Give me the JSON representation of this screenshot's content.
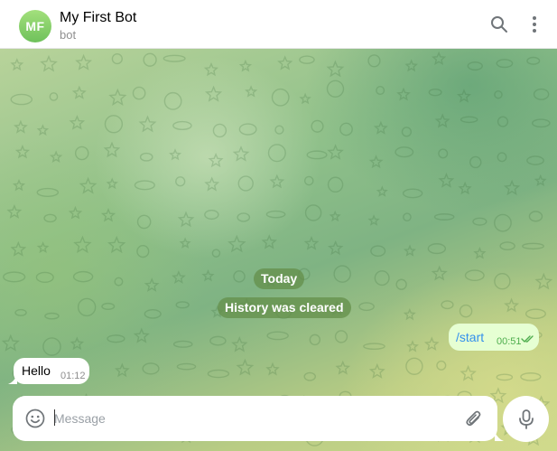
{
  "header": {
    "avatar_initials": "MF",
    "title": "My First Bot",
    "subtitle": "bot",
    "icons": [
      "search-icon",
      "more-vertical-icon"
    ]
  },
  "chat": {
    "date_label": "Today",
    "service_message": "History was cleared",
    "messages": [
      {
        "direction": "outgoing",
        "text": "/start",
        "time": "00:51",
        "status": "read"
      },
      {
        "direction": "incoming",
        "text": "Hello",
        "time": "01:12"
      }
    ]
  },
  "composer": {
    "placeholder": "Message",
    "value": "",
    "icons": [
      "emoji-icon",
      "attach-icon",
      "microphone-icon"
    ]
  },
  "colors": {
    "accent": "#3390ec",
    "avatar": "#8fd16e",
    "outgoing_bubble": "#e6ffd3",
    "outgoing_time": "#4fae4e",
    "incoming_time": "#8f8f8f",
    "service_pill": "#628e48"
  }
}
